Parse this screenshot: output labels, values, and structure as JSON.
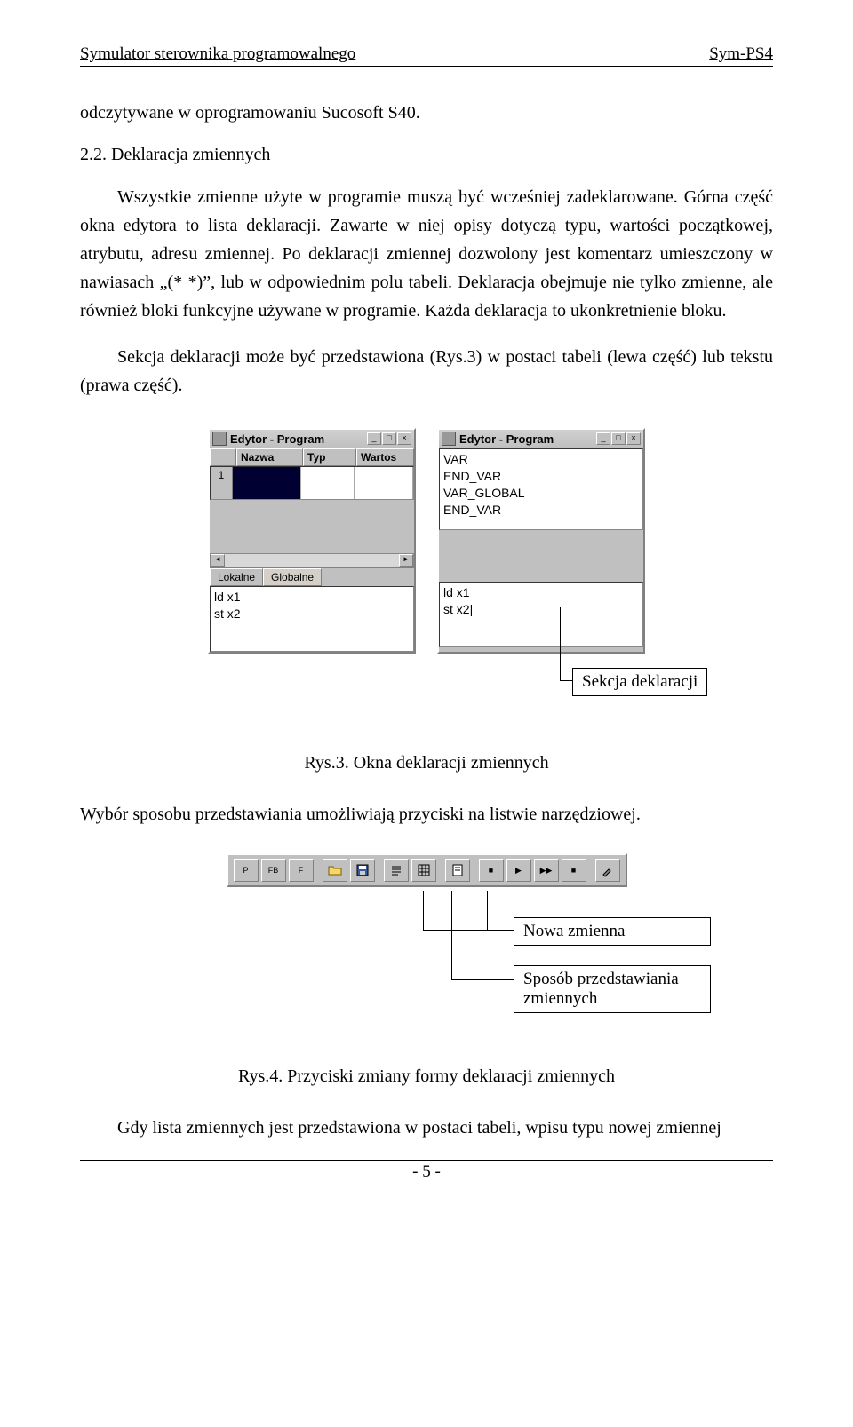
{
  "header": {
    "left": "Symulator sterownika programowalnego",
    "right": "Sym-PS4"
  },
  "para1": "odczytywane w oprogramowaniu Sucosoft S40.",
  "section_title": "2.2. Deklaracja zmiennych",
  "para2": "Wszystkie zmienne użyte w programie muszą być wcześniej zadeklarowane. Górna część okna edytora to lista deklaracji. Zawarte w niej opisy dotyczą typu, wartości początkowej, atrybutu, adresu zmiennej. Po deklaracji zmiennej dozwolony jest komentarz umieszczony w nawiasach „(*  *)”, lub w odpowiednim polu tabeli. Deklaracja obejmuje nie tylko zmienne, ale również bloki funkcyjne używane w programie. Każda deklaracja to ukonkretnienie bloku.",
  "para3": "Sekcja deklaracji może być przedstawiona (Rys.3) w postaci tabeli (lewa część) lub tekstu (prawa część).",
  "win_left": {
    "title": "Edytor - Program",
    "cols": [
      "Nazwa",
      "Typ",
      "Wartos"
    ],
    "rownum": "1",
    "tabs": [
      "Lokalne",
      "Globalne"
    ],
    "code": [
      "ld x1",
      "st x2"
    ]
  },
  "win_right": {
    "title": "Edytor - Program",
    "text": [
      "VAR",
      "END_VAR",
      "VAR_GLOBAL",
      "END_VAR"
    ],
    "code": [
      "ld x1",
      "st x2|"
    ]
  },
  "callout1": "Sekcja deklaracji",
  "fig3_caption": "Rys.3. Okna deklaracji zmiennych",
  "para4": "Wybór sposobu przedstawiania umożliwiają przyciski na listwie narzędziowej.",
  "toolbar": {
    "g1": [
      "P",
      "FB",
      "F"
    ],
    "g5": [
      "■",
      "▶",
      "▶▶",
      "■"
    ]
  },
  "callout2": "Nowa zmienna",
  "callout3": "Sposób przedstawiania zmiennych",
  "fig4_caption": "Rys.4. Przyciski zmiany formy deklaracji zmiennych",
  "para5": "Gdy lista zmiennych jest przedstawiona w postaci tabeli, wpisu typu nowej zmiennej",
  "page_number": "- 5 -"
}
